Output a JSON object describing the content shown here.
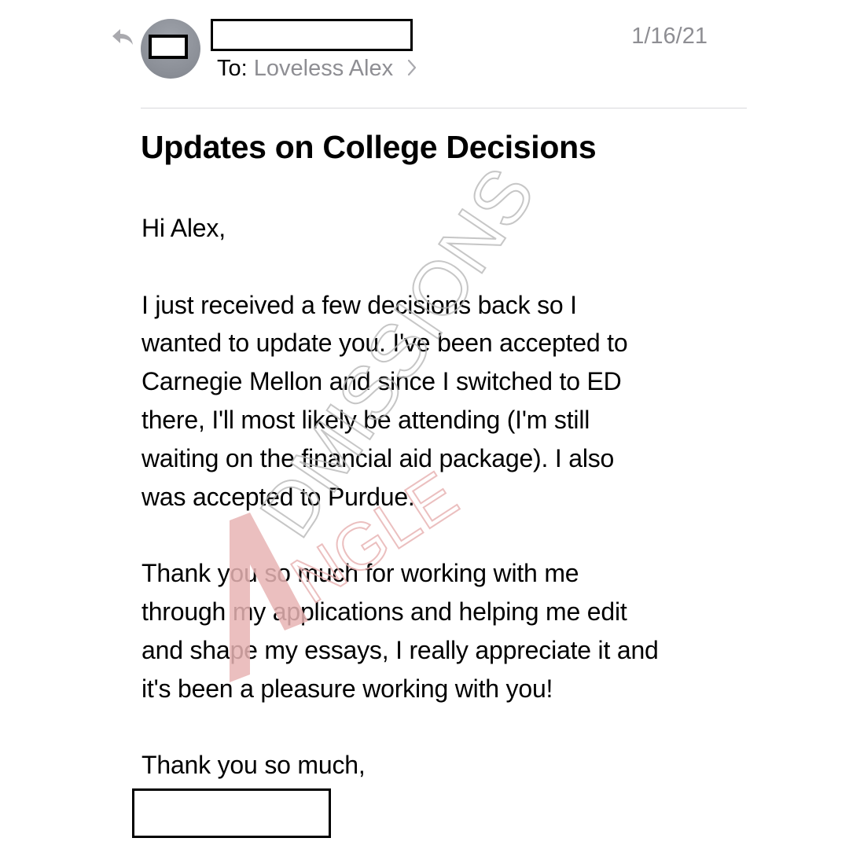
{
  "header": {
    "date": "1/16/21",
    "to_label": "To:",
    "recipient": "Loveless Alex"
  },
  "icons": {
    "reply": "reply-arrow-icon",
    "chevron": "chevron-right-icon"
  },
  "subject": "Updates on College Decisions",
  "body": {
    "greeting": "Hi Alex,",
    "para1": [
      "I just received a few decisions back so I",
      "wanted to update you. I've been accepted to",
      "Carnegie Mellon and since I switched to ED",
      "there, I'll most likely be attending (I'm still",
      "waiting on the financial aid package). I also",
      "was accepted to Purdue."
    ],
    "para2": [
      "Thank you so much for working with me",
      "through my applications and helping me edit",
      "and shape my essays, I really appreciate it and",
      "it's been a pleasure working with you!"
    ],
    "closing": "Thank you so much,"
  },
  "watermark": {
    "line1": "DMISSIONS",
    "line2": "NGLE",
    "mark_color": "#e8b4b4",
    "text_color": "#b8b8b8"
  },
  "colors": {
    "secondary_text": "#8e8e93",
    "divider": "#d8d8dc"
  }
}
